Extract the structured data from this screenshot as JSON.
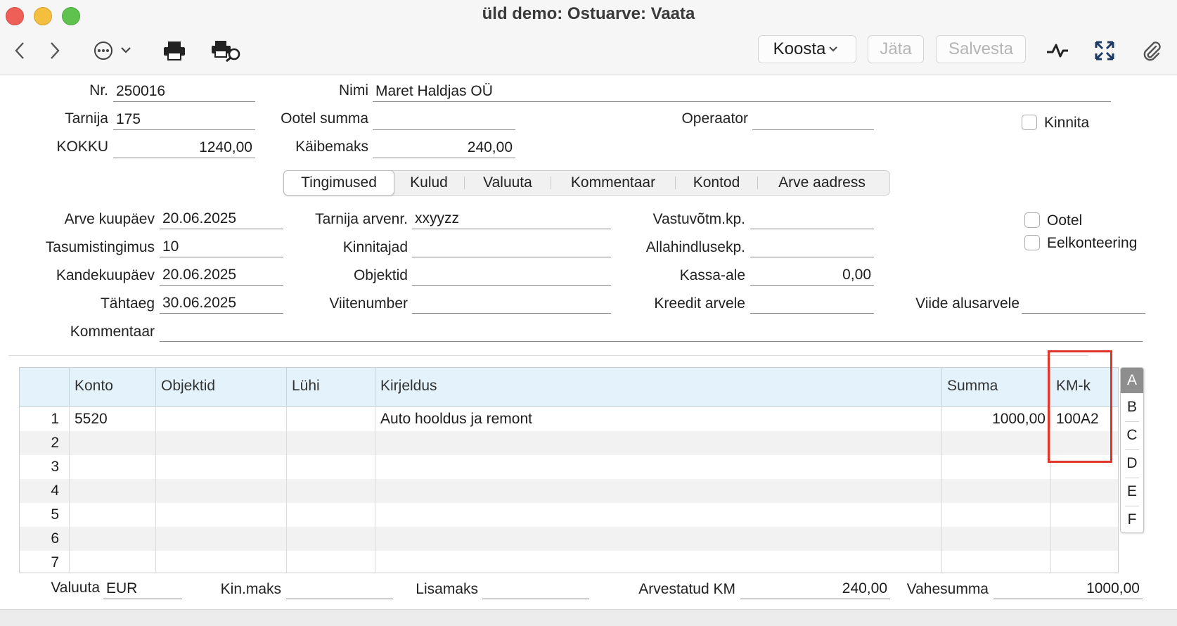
{
  "window": {
    "title": "üld demo: Ostuarve: Vaata"
  },
  "toolbar": {
    "compose_label": "Koosta",
    "discard_label": "Jäta",
    "save_label": "Salvesta"
  },
  "header": {
    "nr_label": "Nr.",
    "nr_value": "250016",
    "name_label": "Nimi",
    "name_value": "Maret Haldjas OÜ",
    "supplier_label": "Tarnija",
    "supplier_value": "175",
    "pending_sum_label": "Ootel summa",
    "pending_sum_value": "",
    "operator_label": "Operaator",
    "operator_value": "",
    "confirm_label": "Kinnita",
    "total_label": "KOKKU",
    "total_value": "1240,00",
    "vat_label": "Käibemaks",
    "vat_value": "240,00"
  },
  "tabs": [
    {
      "label": "Tingimused",
      "selected": true
    },
    {
      "label": "Kulud"
    },
    {
      "label": "Valuuta"
    },
    {
      "label": "Kommentaar"
    },
    {
      "label": "Kontod"
    },
    {
      "label": "Arve aadress"
    }
  ],
  "terms": {
    "invoice_date_label": "Arve kuupäev",
    "invoice_date_value": "20.06.2025",
    "payment_terms_label": "Tasumistingimus",
    "payment_terms_value": "10",
    "entry_date_label": "Kandekuupäev",
    "entry_date_value": "20.06.2025",
    "due_date_label": "Tähtaeg",
    "due_date_value": "30.06.2025",
    "supplier_invno_label": "Tarnija arvenr.",
    "supplier_invno_value": "xxyyzz",
    "approvers_label": "Kinnitajad",
    "approvers_value": "",
    "objects_label": "Objektid",
    "objects_value": "",
    "ref_label": "Viitenumber",
    "ref_value": "",
    "received_label": "Vastuvõtm.kp.",
    "received_value": "",
    "discount_date_label": "Allahindlusekp.",
    "discount_date_value": "",
    "cash_discount_label": "Kassa-ale",
    "cash_discount_value": "0,00",
    "credit_label": "Kreedit arvele",
    "credit_value": "",
    "base_invoice_label": "Viide alusarvele",
    "base_invoice_value": "",
    "pending_label": "Ootel",
    "preaccount_label": "Eelkonteering",
    "comment_label": "Kommentaar",
    "comment_value": ""
  },
  "grid": {
    "columns": [
      "Konto",
      "Objektid",
      "Lühi",
      "Kirjeldus",
      "Summa",
      "KM-k"
    ],
    "rows": [
      {
        "n": "1",
        "konto": "5520",
        "objektid": "",
        "luhi": "",
        "kirjeldus": "Auto hooldus ja remont",
        "summa": "1000,00",
        "kmk": "100A2"
      },
      {
        "n": "2",
        "konto": "",
        "objektid": "",
        "luhi": "",
        "kirjeldus": "",
        "summa": "",
        "kmk": ""
      },
      {
        "n": "3",
        "konto": "",
        "objektid": "",
        "luhi": "",
        "kirjeldus": "",
        "summa": "",
        "kmk": ""
      },
      {
        "n": "4",
        "konto": "",
        "objektid": "",
        "luhi": "",
        "kirjeldus": "",
        "summa": "",
        "kmk": ""
      },
      {
        "n": "5",
        "konto": "",
        "objektid": "",
        "luhi": "",
        "kirjeldus": "",
        "summa": "",
        "kmk": ""
      },
      {
        "n": "6",
        "konto": "",
        "objektid": "",
        "luhi": "",
        "kirjeldus": "",
        "summa": "",
        "kmk": ""
      },
      {
        "n": "7",
        "konto": "",
        "objektid": "",
        "luhi": "",
        "kirjeldus": "",
        "summa": "",
        "kmk": ""
      }
    ],
    "letters": [
      "A",
      "B",
      "C",
      "D",
      "E",
      "F"
    ]
  },
  "footer": {
    "currency_label": "Valuuta",
    "currency_value": "EUR",
    "kinmaks_label": "Kin.maks",
    "kinmaks_value": "",
    "lisamaks_label": "Lisamaks",
    "lisamaks_value": "",
    "calc_vat_label": "Arvestatud KM",
    "calc_vat_value": "240,00",
    "subtotal_label": "Vahesumma",
    "subtotal_value": "1000,00"
  },
  "colors": {
    "highlight_box": "#e0352b",
    "grid_header": "#e4f3fb"
  }
}
